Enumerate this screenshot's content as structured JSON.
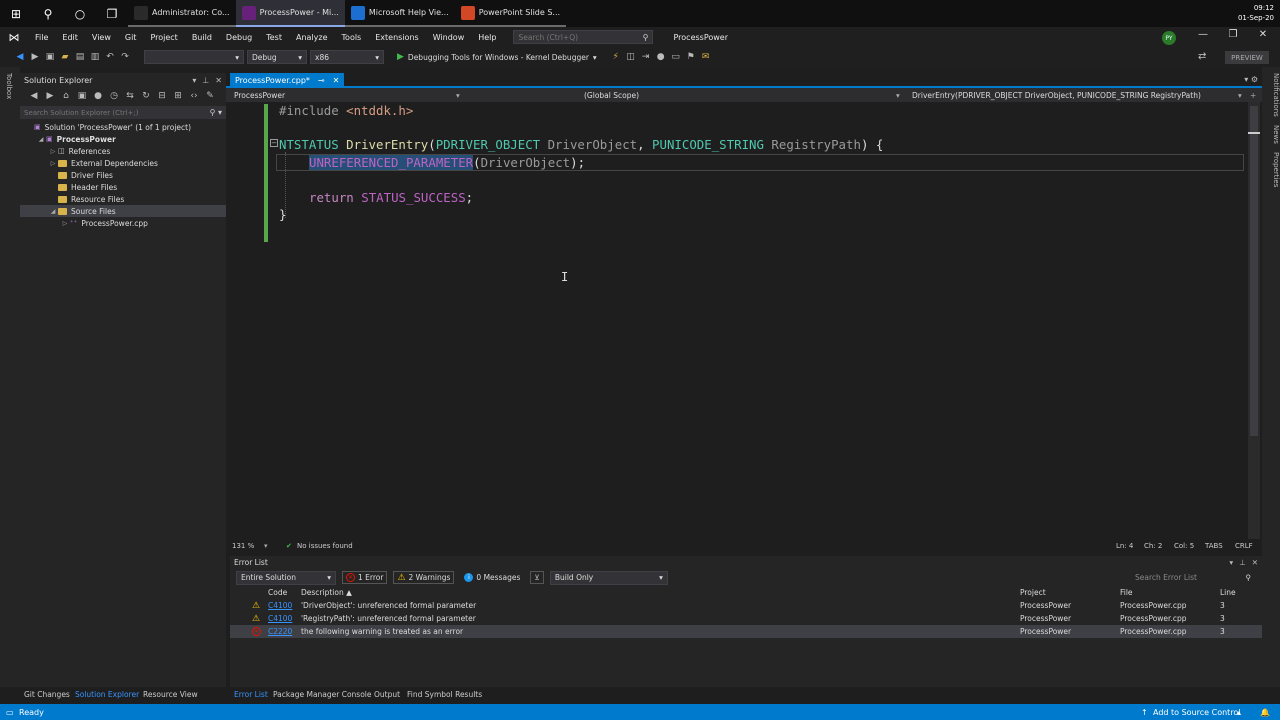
{
  "taskbar": {
    "apps": [
      {
        "label": "Administrator: Co...",
        "active": false,
        "color": "#2a2a2a"
      },
      {
        "label": "ProcessPower - Mi...",
        "active": true,
        "color": "#68217a"
      },
      {
        "label": "Microsoft Help Vie...",
        "active": false,
        "color": "#1c6ed1"
      },
      {
        "label": "PowerPoint Slide S...",
        "active": false,
        "color": "#d24726"
      }
    ],
    "time": "09:12",
    "date": "01-Sep-20"
  },
  "menubar": {
    "items": [
      "File",
      "Edit",
      "View",
      "Git",
      "Project",
      "Build",
      "Debug",
      "Test",
      "Analyze",
      "Tools",
      "Extensions",
      "Window",
      "Help"
    ],
    "search_placeholder": "Search (Ctrl+Q)",
    "project_title": "ProcessPower",
    "avatar": "PY"
  },
  "toolbar": {
    "config": "Debug",
    "platform": "x86",
    "run_label": "Debugging Tools for Windows - Kernel Debugger",
    "preview": "PREVIEW"
  },
  "left_strip": {
    "label": "Toolbox"
  },
  "solution_explorer": {
    "title": "Solution Explorer",
    "search_placeholder": "Search Solution Explorer (Ctrl+;)",
    "tree": [
      {
        "label": "Solution 'ProcessPower' (1 of 1 project)",
        "indent": 0,
        "arrow": "",
        "kind": "solution"
      },
      {
        "label": "ProcessPower",
        "indent": 1,
        "arrow": "◢",
        "kind": "project"
      },
      {
        "label": "References",
        "indent": 2,
        "arrow": "▷",
        "kind": "ref"
      },
      {
        "label": "External Dependencies",
        "indent": 2,
        "arrow": "▷",
        "kind": "folder"
      },
      {
        "label": "Driver Files",
        "indent": 2,
        "arrow": "",
        "kind": "folder"
      },
      {
        "label": "Header Files",
        "indent": 2,
        "arrow": "",
        "kind": "folder"
      },
      {
        "label": "Resource Files",
        "indent": 2,
        "arrow": "",
        "kind": "folder"
      },
      {
        "label": "Source Files",
        "indent": 2,
        "arrow": "◢",
        "kind": "folder"
      },
      {
        "label": "ProcessPower.cpp",
        "indent": 3,
        "arrow": "▷",
        "kind": "cpp"
      }
    ]
  },
  "editor": {
    "tab_label": "ProcessPower.cpp*",
    "nav_project": "ProcessPower",
    "nav_scope": "(Global Scope)",
    "nav_member": "DriverEntry(PDRIVER_OBJECT DriverObject, PUNICODE_STRING RegistryPath)",
    "zoom": "131 %",
    "issues": "No issues found",
    "ln": "Ln: 4",
    "ch": "Ch: 2",
    "col": "Col: 5",
    "tabs": "TABS",
    "eol": "CRLF"
  },
  "code": {
    "l1_pre": "#include ",
    "l1_hdr": "<ntddk.h>",
    "l2_type": "NTSTATUS",
    "l2_fn": "DriverEntry",
    "l2_p1t": "PDRIVER_OBJECT",
    "l2_p1n": "DriverObject",
    "l2_p2t": "PUNICODE_STRING",
    "l2_p2n": "RegistryPath",
    "l3_macro": "UNREFERENCED_PARAMETER",
    "l3_arg": "DriverObject",
    "l5_kw": "return",
    "l5_val": "STATUS_SUCCESS"
  },
  "error_list": {
    "title": "Error List",
    "scope": "Entire Solution",
    "errors": "1 Error",
    "warnings": "2 Warnings",
    "messages": "0 Messages",
    "build": "Build Only",
    "search_placeholder": "Search Error List",
    "headers": {
      "code": "Code",
      "desc": "Description",
      "project": "Project",
      "file": "File",
      "line": "Line"
    },
    "rows": [
      {
        "sev": "warning",
        "code": "C4100",
        "desc": "'DriverObject': unreferenced formal parameter",
        "project": "ProcessPower",
        "file": "ProcessPower.cpp",
        "line": "3"
      },
      {
        "sev": "warning",
        "code": "C4100",
        "desc": "'RegistryPath': unreferenced formal parameter",
        "project": "ProcessPower",
        "file": "ProcessPower.cpp",
        "line": "3"
      },
      {
        "sev": "error",
        "code": "C2220",
        "desc": "the following warning is treated as an error",
        "project": "ProcessPower",
        "file": "ProcessPower.cpp",
        "line": "3"
      }
    ]
  },
  "right_strip": [
    "Notifications",
    "News",
    "Properties"
  ],
  "bottom_tabs": {
    "left": [
      "Git Changes",
      "Solution Explorer",
      "Resource View"
    ],
    "right": [
      "Error List",
      "Package Manager Console",
      "Output",
      "Find Symbol Results"
    ]
  },
  "statusbar": {
    "status": "Ready",
    "source_control": "Add to Source Control"
  }
}
